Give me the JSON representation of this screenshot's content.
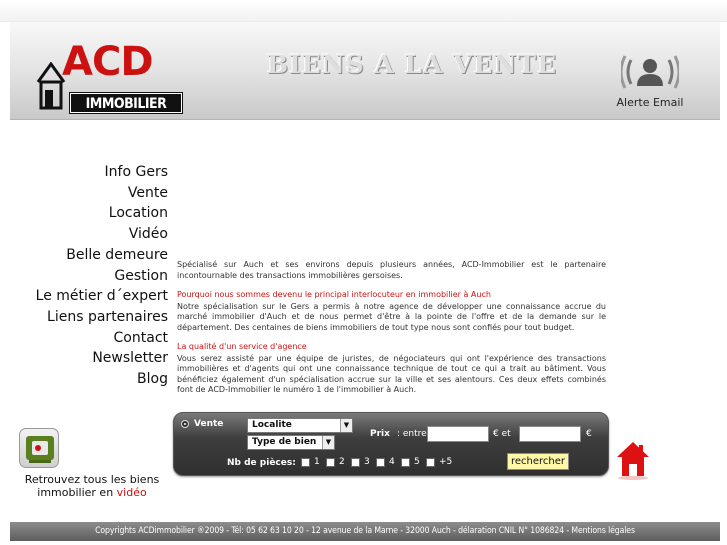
{
  "header": {
    "logo_brand": "ACD",
    "logo_sub": "IMMOBILIER",
    "banner_title": "BIENS A LA VENTE",
    "alert_label": "Alerte Email"
  },
  "nav": {
    "items": [
      {
        "label": "Info Gers"
      },
      {
        "label": "Vente"
      },
      {
        "label": "Location"
      },
      {
        "label": "Vidéo"
      },
      {
        "label": "Belle demeure"
      },
      {
        "label": "Gestion"
      },
      {
        "label": "Le métier d´expert"
      },
      {
        "label": "Liens partenaires"
      },
      {
        "label": "Contact"
      },
      {
        "label": "Newsletter"
      },
      {
        "label": "Blog"
      }
    ]
  },
  "content": {
    "intro": "Spécialisé sur Auch et ses environs depuis plusieurs années, ACD-Immobilier est le partenaire incontournable des transactions immobilières gersoises.",
    "section1_title": "Pourquoi nous sommes devenu le principal interlocuteur en immobilier à Auch",
    "section1_body": "Notre spécialisation sur le Gers a permis à notre agence de développer une connaissance accrue du marché immobilier d'Auch et de nous permet d'être à la pointe de l'offre et de la demande sur le département. Des centaines de biens immobiliers de tout type nous sont confiés pour tout budget.",
    "section2_title": "La qualité d'un service d'agence",
    "section2_body": "Vous serez assisté par une équipe de juristes, de négociateurs qui ont l'expérience des transactions immobilières et d'agents qui ont une connaissance technique de tout ce qui a trait au bâtiment. Vous bénéficiez également d'un spécialisation accrue sur la ville et ses alentours. Ces deux effets combinés font de ACD-Immobilier le numéro 1 de l'immobilier à Auch."
  },
  "search": {
    "mode_label": "Vente",
    "localite_value": "Localite",
    "type_value": "Type de bien",
    "price_label": "Prix",
    "price_between": ": entre",
    "price_unit_and": "€ et",
    "price_unit_end": "€",
    "price_min": "",
    "price_max": "",
    "rooms_label": "Nb de pièces:",
    "rooms": [
      "1",
      "2",
      "3",
      "4",
      "5",
      "+5"
    ],
    "submit_label": "rechercher"
  },
  "video": {
    "caption_line": "Retrouvez tous les biens immobilier en",
    "caption_link": "vidéo"
  },
  "footer": {
    "text": "Copyrights ACDimmobilier ®2009   -   Tél: 05 62 63 10 20 - 12 avenue de la Marne - 32000 Auch   -   délaration CNIL N° 1086824  -  Mentions légales"
  },
  "colors": {
    "accent_red": "#cc1111",
    "button_yellow": "#fff7a8",
    "panel_dark": "#2f2f2f"
  }
}
